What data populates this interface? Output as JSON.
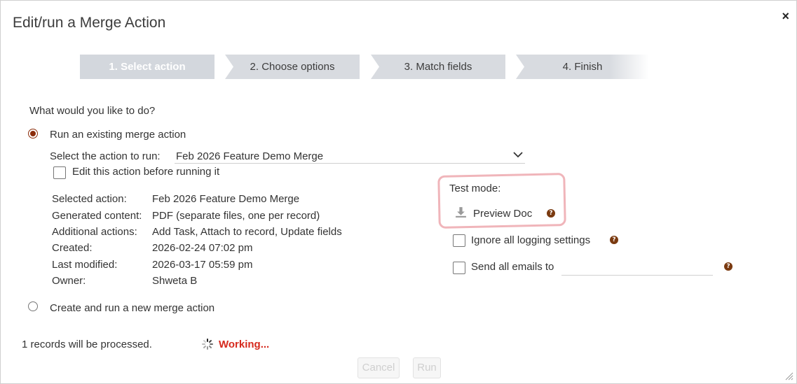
{
  "dialog": {
    "title": "Edit/run a Merge Action",
    "close_label": "×"
  },
  "steps": [
    {
      "label": "1. Select action",
      "active": true
    },
    {
      "label": "2. Choose options",
      "active": false
    },
    {
      "label": "3. Match fields",
      "active": false
    },
    {
      "label": "4. Finish",
      "active": false
    }
  ],
  "question": "What would you like to do?",
  "option_existing": {
    "label": "Run an existing merge action",
    "selected": true,
    "select_label": "Select the action to run:",
    "select_value": "Feb 2026 Feature Demo Merge",
    "edit_checkbox_label": "Edit this action before running it",
    "edit_checkbox_checked": false
  },
  "details": [
    {
      "label": "Selected action:",
      "value": "Feb 2026 Feature Demo Merge"
    },
    {
      "label": "Generated content:",
      "value": "PDF (separate files, one per record)"
    },
    {
      "label": "Additional actions:",
      "value": "Add Task, Attach to record, Update fields"
    },
    {
      "label": "Created:",
      "value": "2026-02-24 07:02 pm"
    },
    {
      "label": "Last modified:",
      "value": "2026-03-17 05:59 pm"
    },
    {
      "label": "Owner:",
      "value": "Shweta B"
    }
  ],
  "test_mode": {
    "label": "Test mode:",
    "preview_label": "Preview Doc",
    "help_glyph": "?",
    "highlight_color": "#f0b5ba"
  },
  "options": {
    "ignore_logging_label": "Ignore all logging settings",
    "ignore_logging_checked": false,
    "send_emails_label": "Send all emails to",
    "send_emails_checked": false,
    "send_emails_value": ""
  },
  "option_new": {
    "label": "Create and run a new merge action",
    "selected": false
  },
  "footer": {
    "records_text": "1 records will be processed.",
    "working_text": "Working...",
    "cancel_label": "Cancel",
    "run_label": "Run"
  },
  "colors": {
    "accent": "#8b2c0a",
    "working": "#d62a1e",
    "step_bg": "#d8dbe0"
  },
  "icons": [
    "close-icon",
    "chevron-down-icon",
    "download-icon",
    "help-icon",
    "spinner-icon",
    "resize-handle-icon"
  ]
}
